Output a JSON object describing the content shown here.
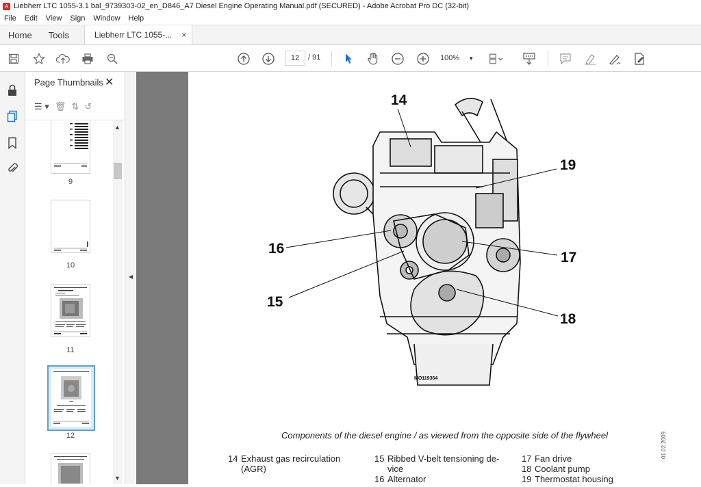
{
  "window": {
    "title": "Liebherr LTC 1055-3.1 bal_9739303-02_en_D846_A7 Diesel Engine Operating Manual.pdf (SECURED) - Adobe Acrobat Pro DC (32-bit)"
  },
  "menu": [
    "File",
    "Edit",
    "View",
    "Sign",
    "Window",
    "Help"
  ],
  "tabs": {
    "home": "Home",
    "tools": "Tools",
    "doc": "Liebherr LTC 1055-...",
    "doc_close": "×"
  },
  "toolbar": {
    "icons": [
      "save-icon",
      "bookmark-star-icon",
      "upload-cloud-icon",
      "print-icon",
      "find-icon",
      "page-up-icon",
      "page-down-icon",
      "select-pointer-icon",
      "hand-icon",
      "zoom-out-icon",
      "zoom-in-icon",
      "page-layout-icon",
      "read-mode-icon",
      "comment-icon",
      "highlight-icon",
      "sign-icon",
      "edit-pdf-icon"
    ],
    "page_current": "12",
    "page_total": "/ 91",
    "zoom_value": "100%"
  },
  "thumbnails": {
    "header": "Page Thumbnails",
    "close": "✕",
    "pages": [
      {
        "label": "9"
      },
      {
        "label": "10"
      },
      {
        "label": "11"
      },
      {
        "label": "12",
        "selected": true
      }
    ]
  },
  "document": {
    "callouts": {
      "c14": "14",
      "c19": "19",
      "c16": "16",
      "c17": "17",
      "c15": "15",
      "c18": "18"
    },
    "figure_code": "MO119364",
    "caption": "Components of the diesel engine / as viewed from the opposite side of the flywheel",
    "legend": [
      {
        "num": "14",
        "text": "Exhaust gas recirculation",
        "cont": "(AGR)"
      },
      {
        "num": "15",
        "text": "Ribbed V-belt tensioning de-",
        "cont": "vice"
      },
      {
        "num": "16",
        "text": "Alternator"
      },
      {
        "num": "17",
        "text": "Fan drive"
      },
      {
        "num": "18",
        "text": "Coolant pump"
      },
      {
        "num": "19",
        "text": "Thermostat housing"
      }
    ],
    "side_stamp": "01.02.2009"
  },
  "colors": {
    "accent": "#1473e6",
    "canvas_bg": "#7a7a7a",
    "thumb_selected": "#5aa0d6"
  }
}
